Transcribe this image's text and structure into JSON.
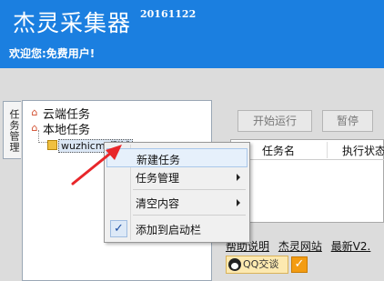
{
  "header": {
    "title": "杰灵采集器",
    "version": "20161122",
    "welcome": "欢迎您:免费用户!",
    "bg_color": "#1b7fe0"
  },
  "left_tab": {
    "label": "任务管理"
  },
  "tree": {
    "items": [
      {
        "label": "云端任务",
        "icon": "cloud-task-icon"
      },
      {
        "label": "本地任务",
        "icon": "local-task-icon"
      }
    ],
    "selected_task_label": "wuzhicm_测试"
  },
  "toolbar": {
    "start_label": "开始运行",
    "pause_label": "暂停"
  },
  "task_grid": {
    "columns": [
      "任务名",
      "执行状态"
    ]
  },
  "footer_links": [
    "帮助说明",
    "杰灵网站",
    "最新V2."
  ],
  "qq_button": {
    "label": "QQ交谈"
  },
  "context_menu": {
    "items": [
      {
        "label": "新建任务",
        "submenu": false,
        "highlighted": true
      },
      {
        "label": "任务管理",
        "submenu": true
      },
      {
        "label": "清空内容",
        "submenu": true
      },
      {
        "label": "添加到启动栏",
        "checked": true
      }
    ]
  },
  "annotation": {
    "color": "#e8262a"
  }
}
